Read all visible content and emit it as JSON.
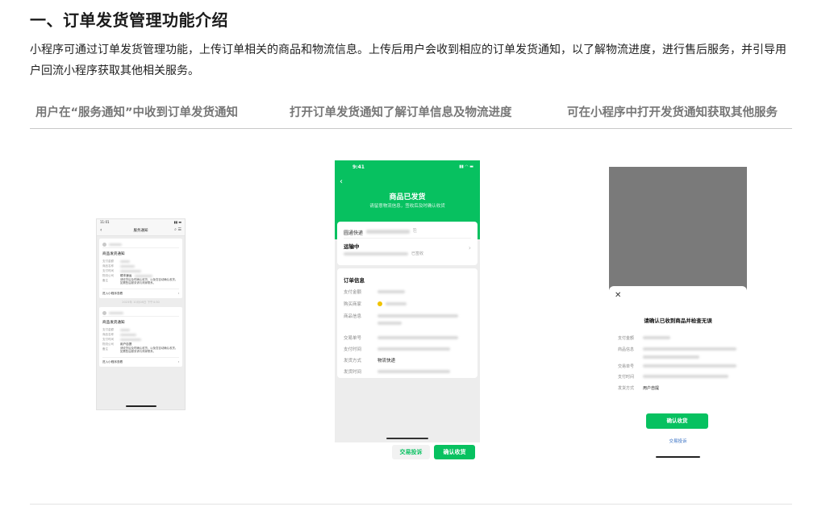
{
  "heading": "一、订单发货管理功能介绍",
  "intro": "小程序可通过订单发货管理功能，上传订单相关的商品和物流信息。上传后用户会收到相应的订单发货通知，以了解物流进度，进行售后服务，并引导用户回流小程序获取其他相关服务。",
  "tabs": [
    {
      "label": "用户在“服务通知”中收到订单发货通知"
    },
    {
      "label": "打开订单发货通知了解订单信息及物流进度"
    },
    {
      "label": "可在小程序中打开发货通知获取其他服务"
    }
  ],
  "phone1": {
    "status_time": "11:01",
    "nav_title": "服务通知",
    "card1_title": "商品发货通知",
    "card2_title": "商品发货通知",
    "divider_text": "2023年 10月08日 下午4:30",
    "enter_label": "进入小程序查看",
    "fields": [
      "支付金额",
      "商品名称",
      "支付时间",
      "物流公司",
      "备注"
    ],
    "card1_logistics": "顺丰速运",
    "card2_logistics": "用户自提",
    "card1_note": "请收货后及时确认收货，以免您自动确认收货。如需售后服务请与商家联系。",
    "card2_note": "请收货后及时确认收货，以免您自动确认收货。如需售后服务请与商家联系。"
  },
  "phone2": {
    "status_time": "9:41",
    "title": "商品已发货",
    "subtitle": "请留意物流信息，签收后及时确认收货",
    "courier_label": "圆通快递",
    "transit_label": "运输中",
    "signed_label": "已签收",
    "order_header": "订单信息",
    "rows": {
      "amount": "支付金额",
      "merchant": "购买商家",
      "goods": "商品信息",
      "trade_no": "交易单号",
      "pay_time": "支付时间",
      "ship_method": "发货方式",
      "ship_time": "发货时间"
    },
    "ship_method_value": "物流快递",
    "complain_button": "交易投诉",
    "confirm_button": "确认收货"
  },
  "phone3": {
    "close_glyph": "✕",
    "title": "请确认已收到商品并检查无误",
    "rows": {
      "amount": "支付金额",
      "goods": "商品信息",
      "trade_no": "交易单号",
      "pay_time": "支付时间",
      "ship_method": "发货方式"
    },
    "ship_method_value": "用户自提",
    "confirm_button": "确认收货",
    "complain_link": "交易投诉"
  },
  "colors": {
    "wechat_green": "#07c160",
    "link_blue": "#3a72c4",
    "tab_gray": "#777777"
  }
}
